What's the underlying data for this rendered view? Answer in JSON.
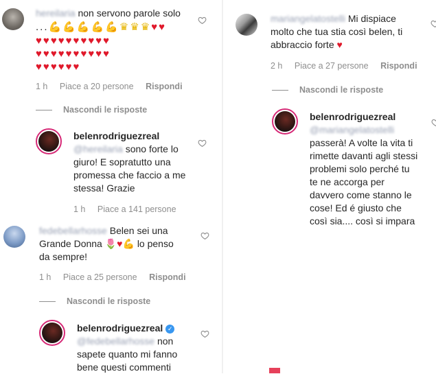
{
  "left": {
    "comment1": {
      "username": "hereilaria",
      "text_start": "non servono parole solo",
      "ellipsis": "...",
      "emoji_line1_muscles": "💪💪💪💪💪",
      "emoji_line1_crowns": "♛♛♛",
      "emoji_line1_hearts": "♥♥",
      "emoji_rows": [
        "♥♥♥♥♥♥♥♥♥♥",
        "♥♥♥♥♥♥♥♥♥♥",
        "♥♥♥♥♥♥"
      ],
      "time": "1 h",
      "likes": "Piace a 20 persone",
      "reply": "Rispondi",
      "hide": "Nascondi le risposte"
    },
    "reply1": {
      "username": "belenrodriguezreal",
      "mention": "@hereilaria",
      "text": "sono forte lo giuro! E sopratutto una promessa che faccio a me stessa! Grazie",
      "time": "1 h",
      "likes": "Piace a 141 persone"
    },
    "comment2": {
      "username": "fedebellarhosse",
      "text1": "Belen sei una",
      "text2": "Grande Donna",
      "emojis": "🌷♥💪",
      "text3": "lo penso",
      "text4": "da sempre!",
      "time": "1 h",
      "likes": "Piace a 25 persone",
      "reply": "Rispondi",
      "hide": "Nascondi le risposte"
    },
    "reply2": {
      "username": "belenrodriguezreal",
      "mention": "@fedebellarhosse",
      "text1": "non",
      "text2": "sapete quanto mi fanno",
      "text3": "bene questi commenti"
    }
  },
  "right": {
    "comment1": {
      "username": "mariangelatostelli",
      "text1": "Mi dispiace",
      "text2": "molto che tua stia così belen, ti",
      "text3": "abbraccio forte",
      "emoji": "♥",
      "time": "2 h",
      "likes": "Piace a 27 persone",
      "reply": "Rispondi",
      "hide": "Nascondi le risposte"
    },
    "reply1": {
      "username": "belenrodriguezreal",
      "mention": "@mariangelatostelli",
      "lines": [
        "passerà! A volte la vita ti",
        "rimette davanti agli stessi",
        "problemi solo perché tu",
        "te ne accorga per",
        "davvero come stanno le",
        "cose! Ed é giusto che",
        "così sia.... così si impara"
      ]
    }
  },
  "colors": {
    "heart": "#e0192b",
    "muted": "#8e8e8e",
    "verified": "#3897f0",
    "ring": "#d62976"
  }
}
